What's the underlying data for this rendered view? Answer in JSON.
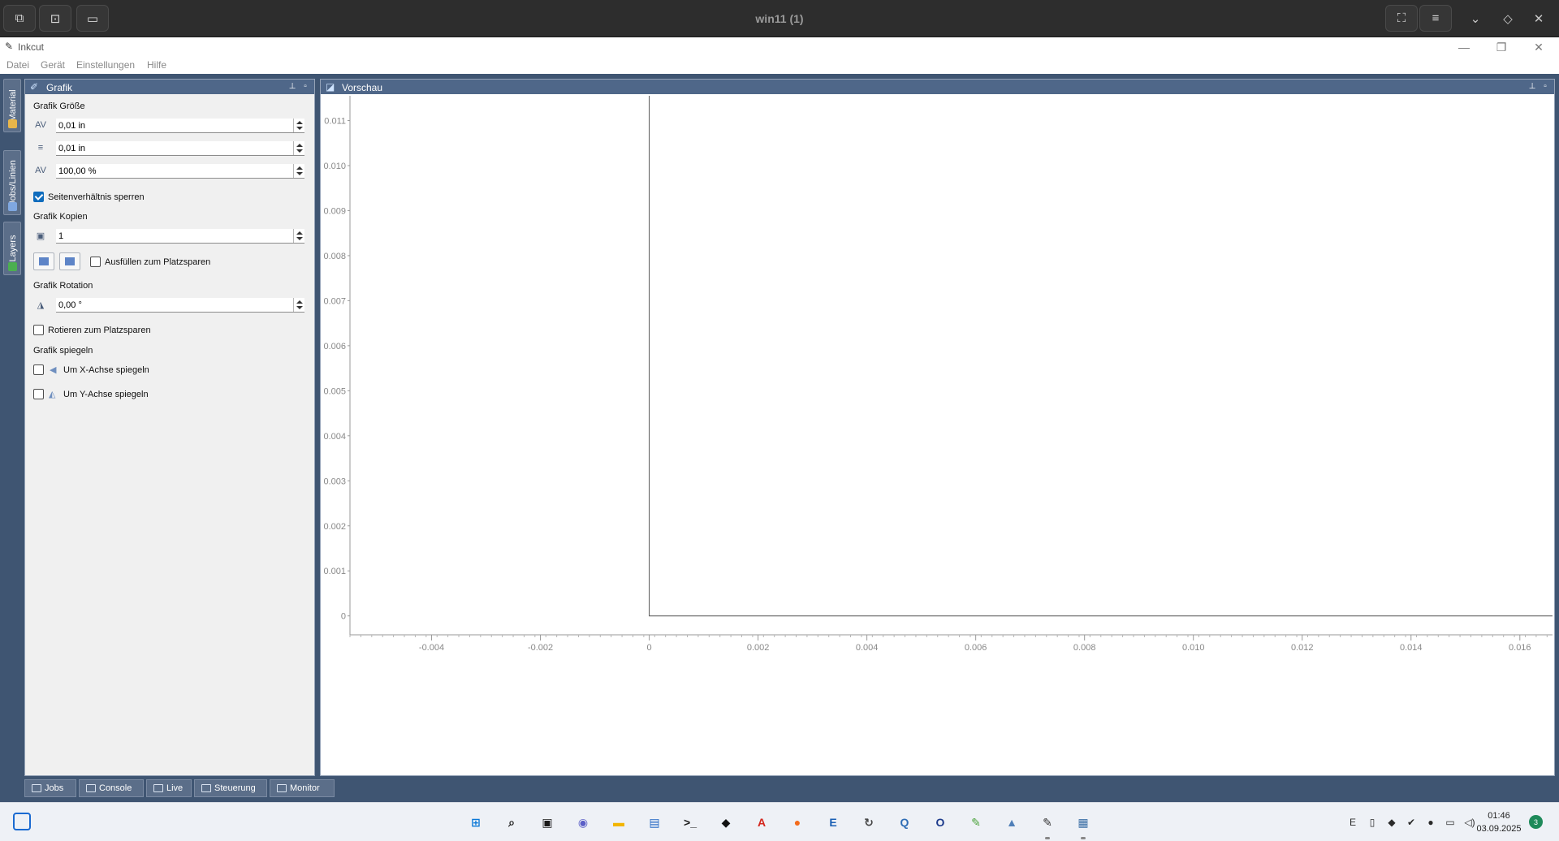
{
  "remote_bar": {
    "title": "win11 (1)",
    "left_icons": [
      "window-switcher-icon",
      "fit-screen-icon",
      "display-icon"
    ],
    "right_icons": [
      "fullscreen-icon",
      "menu-icon",
      "chevron-down-icon",
      "diamond-icon",
      "close-icon"
    ]
  },
  "app": {
    "title": "Inkcut",
    "logo_glyph": "✎",
    "window_controls": {
      "minimize": "—",
      "restore": "❐",
      "close": "✕"
    }
  },
  "menu": [
    "Datei",
    "Gerät",
    "Einstellungen",
    "Hilfe"
  ],
  "side_tabs": [
    {
      "label": "Material",
      "icon_color": "#e8b64a"
    },
    {
      "label": "Jobs/Linien",
      "icon_color": "#7fa7e0"
    },
    {
      "label": "Layers",
      "icon_color": "#4caf50"
    }
  ],
  "grafik": {
    "title": "Grafik",
    "size_label": "Grafik Größe",
    "width_value": "0,01 in",
    "height_value": "0,01 in",
    "scale_value": "100,00 %",
    "lock_aspect_label": "Seitenverhältnis sperren",
    "lock_aspect_checked": true,
    "copies_label": "Grafik Kopien",
    "copies_value": "1",
    "fill_label": "Ausfüllen zum Platzsparen",
    "fill_checked": false,
    "rotation_label": "Grafik Rotation",
    "rotation_value": "0,00 °",
    "rotate_save_label": "Rotieren zum Platzsparen",
    "rotate_save_checked": false,
    "mirror_label": "Grafik spiegeln",
    "mirror_x_label": "Um X-Achse spiegeln",
    "mirror_x_checked": false,
    "mirror_y_label": "Um Y-Achse spiegeln",
    "mirror_y_checked": false
  },
  "vorschau": {
    "title": "Vorschau"
  },
  "chart_data": {
    "type": "line",
    "title": "",
    "xlabel": "",
    "ylabel": "",
    "xlim": [
      -0.0055,
      0.0166
    ],
    "ylim": [
      -0.00042,
      0.01155
    ],
    "x_ticks": [
      "-0.004",
      "-0.002",
      "0",
      "0.002",
      "0.004",
      "0.006",
      "0.008",
      "0.010",
      "0.012",
      "0.014",
      "0.016"
    ],
    "x_tick_values": [
      -0.004,
      -0.002,
      0,
      0.002,
      0.004,
      0.006,
      0.008,
      0.01,
      0.012,
      0.014,
      0.016
    ],
    "y_ticks": [
      "0",
      "0.001",
      "0.002",
      "0.003",
      "0.004",
      "0.005",
      "0.006",
      "0.007",
      "0.008",
      "0.009",
      "0.010",
      "0.011"
    ],
    "y_tick_values": [
      0,
      0.001,
      0.002,
      0.003,
      0.004,
      0.005,
      0.006,
      0.007,
      0.008,
      0.009,
      0.01,
      0.011
    ],
    "grid": false,
    "series": [
      {
        "values": [
          [
            0,
            0.01155
          ],
          [
            0,
            0
          ],
          [
            0.0166,
            0
          ]
        ]
      }
    ]
  },
  "bottom_tabs": [
    "Jobs",
    "Console",
    "Live",
    "Steuerung",
    "Monitor"
  ],
  "taskbar": {
    "apps": [
      {
        "name": "start-icon",
        "glyph": "⊞",
        "color": "#0a78d7"
      },
      {
        "name": "search-icon",
        "glyph": "⌕",
        "color": "#1a1a1a"
      },
      {
        "name": "task-view-icon",
        "glyph": "▣",
        "color": "#1a1a1a"
      },
      {
        "name": "teams-icon",
        "glyph": "◉",
        "color": "#5b5fc7"
      },
      {
        "name": "file-explorer-icon",
        "glyph": "▬",
        "color": "#f2b500"
      },
      {
        "name": "store-icon",
        "glyph": "▤",
        "color": "#2468c3"
      },
      {
        "name": "terminal-icon",
        "glyph": ">_",
        "color": "#1c1c1c"
      },
      {
        "name": "inkscape-icon",
        "glyph": "◆",
        "color": "#111111"
      },
      {
        "name": "acrobat-icon",
        "glyph": "A",
        "color": "#d3261d"
      },
      {
        "name": "firefox-icon",
        "glyph": "●",
        "color": "#f36b1c"
      },
      {
        "name": "outlook-icon",
        "glyph": "E",
        "color": "#1a5fb4"
      },
      {
        "name": "sync-icon",
        "glyph": "↻",
        "color": "#444444"
      },
      {
        "name": "qt-icon",
        "glyph": "Q",
        "color": "#2f6db5"
      },
      {
        "name": "opera-icon",
        "glyph": "O",
        "color": "#1d3b8c"
      },
      {
        "name": "notepad-icon",
        "glyph": "✎",
        "color": "#4aa23a"
      },
      {
        "name": "monitor-app-icon",
        "glyph": "▲",
        "color": "#4f7fb8"
      },
      {
        "name": "inkcut-icon",
        "glyph": "✎",
        "color": "#333333"
      },
      {
        "name": "python-icon",
        "glyph": "▦",
        "color": "#3a6ea5"
      }
    ],
    "tray": [
      {
        "name": "outlook-tray-icon",
        "glyph": "E"
      },
      {
        "name": "usb-icon",
        "glyph": "▯"
      },
      {
        "name": "defender-icon",
        "glyph": "◆"
      },
      {
        "name": "vpn-icon",
        "glyph": "✔"
      },
      {
        "name": "norton-icon",
        "glyph": "●"
      },
      {
        "name": "network-icon",
        "glyph": "▭"
      },
      {
        "name": "volume-icon",
        "glyph": "◁)"
      }
    ],
    "time": "01:46",
    "date": "03.09.2025",
    "notifications": "3"
  }
}
